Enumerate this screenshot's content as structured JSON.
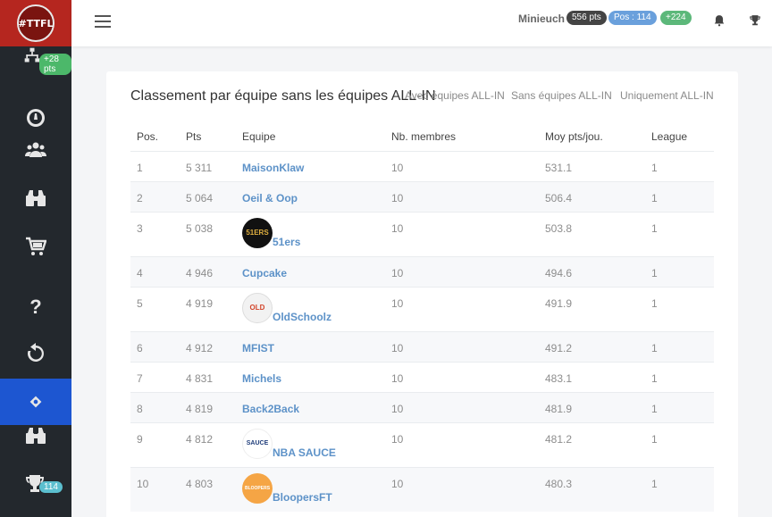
{
  "sidebar": {
    "logo_text": "#TTFL",
    "badge_top": "+28 pts",
    "badge_bottom": "114",
    "icons": [
      "network-icon",
      "gauge-icon",
      "users-icon",
      "binoculars-icon",
      "cart-icon",
      "question-icon",
      "refresh-icon",
      "team-icon",
      "binoculars-icon",
      "trophy-icon"
    ],
    "active_color": "#1d56d1"
  },
  "topbar": {
    "username": "Minieuch",
    "points": "556 pts",
    "position": "Pos : 114",
    "delta": "+224"
  },
  "card": {
    "title": "Classement par équipe sans les équipes ALL-IN",
    "filters": [
      "Avec équipes ALL-IN",
      "Sans équipes ALL-IN",
      "Uniquement ALL-IN"
    ],
    "columns": [
      "Pos.",
      "Pts",
      "Equipe",
      "Nb. membres",
      "Moy pts/jou.",
      "League"
    ],
    "rows": [
      {
        "pos": "1",
        "pts": "5 311",
        "team": "MaisonKlaw",
        "members": "10",
        "avg": "531.1",
        "league": "1"
      },
      {
        "pos": "2",
        "pts": "5 064",
        "team": "Oeil & Oop",
        "members": "10",
        "avg": "506.4",
        "league": "1"
      },
      {
        "pos": "3",
        "pts": "5 038",
        "team": "51ers",
        "members": "10",
        "avg": "503.8",
        "league": "1",
        "logo_text": "51ERS"
      },
      {
        "pos": "4",
        "pts": "4 946",
        "team": "Cupcake",
        "members": "10",
        "avg": "494.6",
        "league": "1"
      },
      {
        "pos": "5",
        "pts": "4 919",
        "team": "OldSchoolz",
        "members": "10",
        "avg": "491.9",
        "league": "1",
        "logo_text": "OLD"
      },
      {
        "pos": "6",
        "pts": "4 912",
        "team": "MFIST",
        "members": "10",
        "avg": "491.2",
        "league": "1"
      },
      {
        "pos": "7",
        "pts": "4 831",
        "team": "Michels",
        "members": "10",
        "avg": "483.1",
        "league": "1"
      },
      {
        "pos": "8",
        "pts": "4 819",
        "team": "Back2Back",
        "members": "10",
        "avg": "481.9",
        "league": "1"
      },
      {
        "pos": "9",
        "pts": "4 812",
        "team": "NBA SAUCE",
        "members": "10",
        "avg": "481.2",
        "league": "1",
        "logo_text": "SAUCE"
      },
      {
        "pos": "10",
        "pts": "4 803",
        "team": "BloopersFT",
        "members": "10",
        "avg": "480.3",
        "league": "1",
        "logo_text": "BLOOPERS"
      }
    ]
  }
}
